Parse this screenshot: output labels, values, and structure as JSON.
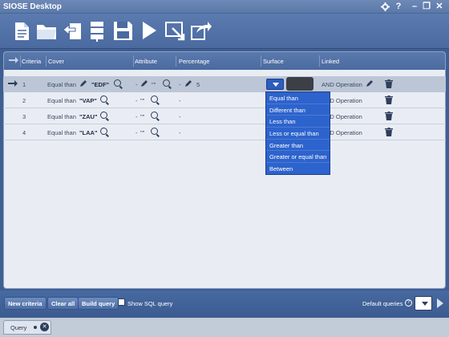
{
  "app": {
    "title": "SIOSE Desktop"
  },
  "titlebar": {
    "settings_icon": "gear-icon",
    "help": "?",
    "minimize": "–",
    "restore": "❐",
    "close": "✕"
  },
  "toolbar": {
    "icons": [
      "new-document-icon",
      "open-folder-icon",
      "import-icon",
      "database-icon",
      "save-icon",
      "run-icon",
      "export-map-icon",
      "share-icon"
    ]
  },
  "grid": {
    "headers": {
      "criteria": "Criteria",
      "cover": "Cover",
      "attribute": "Attribute",
      "percentage": "Percentage",
      "surface": "Surface",
      "linked": "Linked"
    },
    "rows": [
      {
        "num": "1",
        "cover_op": "Equal than",
        "cover_val": "\"EDF\"",
        "attr_op": "-",
        "attr_val": "\"\"",
        "pct_op": "-",
        "pct_val": "5",
        "linked": "AND Operation",
        "active": true
      },
      {
        "num": "2",
        "cover_op": "Equal than",
        "cover_val": "\"VAP\"",
        "attr_op": "-",
        "attr_val": "\"\"",
        "pct_op": "-",
        "pct_val": "",
        "linked": "AND Operation",
        "active": false
      },
      {
        "num": "3",
        "cover_op": "Equal than",
        "cover_val": "\"ZAU\"",
        "attr_op": "-",
        "attr_val": "\"\"",
        "pct_op": "-",
        "pct_val": "",
        "linked": "AND Operation",
        "active": false
      },
      {
        "num": "4",
        "cover_op": "Equal than",
        "cover_val": "\"LAA\"",
        "attr_op": "-",
        "attr_val": "\"\"",
        "pct_op": "-",
        "pct_val": "",
        "linked": "AND Operation",
        "active": false
      }
    ]
  },
  "surface_dropdown": {
    "options": [
      "Equal than",
      "Different than",
      "Less than",
      "Less or equal than",
      "Greater than",
      "Greater or equal than",
      "Between"
    ]
  },
  "footer": {
    "new_criteria": "New criteria",
    "clear_all": "Clear all",
    "build_query": "Build query",
    "show_sql": "Show SQL query",
    "default_queries": "Default queries",
    "help": "?"
  },
  "tabs": [
    {
      "label": "Query"
    }
  ]
}
